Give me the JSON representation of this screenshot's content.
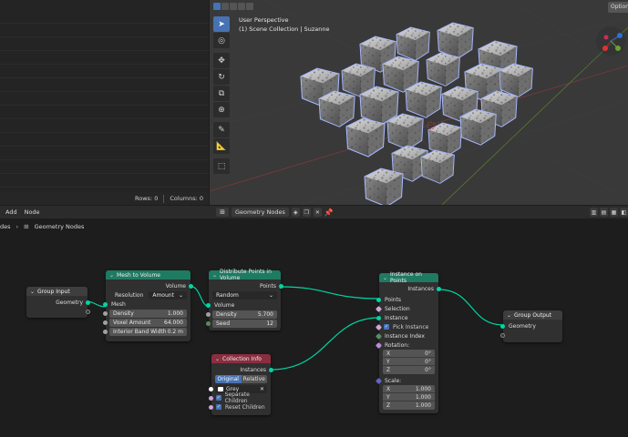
{
  "spreadsheet": {
    "rows_label": "Rows: 0",
    "columns_label": "Columns: 0"
  },
  "viewport": {
    "options_label": "Option",
    "overlay_line1": "User Perspective",
    "overlay_line2": "(1) Scene Collection | Suzanne",
    "tools": [
      "select-tool",
      "cursor-tool",
      "move-tool",
      "rotate-tool",
      "scale-tool",
      "transform-tool",
      "annotate-tool",
      "measure-tool",
      "add-cube-tool"
    ]
  },
  "node_editor": {
    "menu": [
      "Add",
      "Node"
    ],
    "tree_name": "Geometry Nodes",
    "breadcrumb_prefix": "des",
    "breadcrumb": "Geometry Nodes"
  },
  "nodes": {
    "group_input": {
      "title": "Group Input",
      "out_geometry": "Geometry"
    },
    "mesh_to_volume": {
      "title": "Mesh to Volume",
      "out_volume": "Volume",
      "resolution_label": "Resolution",
      "resolution_value": "Amount",
      "in_mesh": "Mesh",
      "density_label": "Density",
      "density_value": "1.000",
      "voxel_label": "Voxel Amount",
      "voxel_value": "64.000",
      "band_label": "Interior Band Width",
      "band_value": "0.2 m"
    },
    "distribute": {
      "title": "Distribute Points in Volume",
      "out_points": "Points",
      "mode_value": "Random",
      "in_volume": "Volume",
      "density_label": "Density",
      "density_value": "5.700",
      "seed_label": "Seed",
      "seed_value": "12"
    },
    "collection_info": {
      "title": "Collection Info",
      "out_instances": "Instances",
      "original": "Original",
      "relative": "Relative",
      "collection_name": "Grey",
      "separate_children": "Separate Children",
      "reset_children": "Reset Children"
    },
    "instance_on_points": {
      "title": "Instance on Points",
      "out_instances": "Instances",
      "in_points": "Points",
      "in_selection": "Selection",
      "in_instance": "Instance",
      "pick_instance": "Pick Instance",
      "instance_index": "Instance Index",
      "rotation_label": "Rotation:",
      "rot_x_label": "X",
      "rot_x": "0°",
      "rot_y_label": "Y",
      "rot_y": "0°",
      "rot_z_label": "Z",
      "rot_z": "0°",
      "scale_label": "Scale:",
      "scale_x_label": "X",
      "scale_x": "1.000",
      "scale_y_label": "Y",
      "scale_y": "1.000",
      "scale_z_label": "Z",
      "scale_z": "1.000"
    },
    "group_output": {
      "title": "Group Output",
      "in_geometry": "Geometry"
    }
  },
  "colors": {
    "geometry_socket": "#00d6a3",
    "geometry_node_header": "#1f7a62",
    "input_node_header": "#8a2e3f",
    "selection_blue": "#4772b3"
  }
}
